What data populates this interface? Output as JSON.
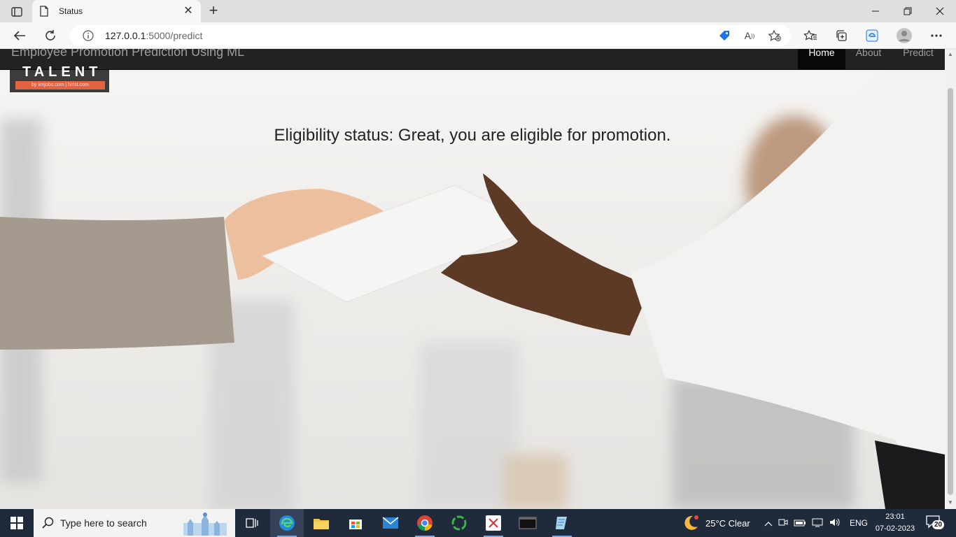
{
  "browser": {
    "tab_title": "Status",
    "address_host": "127.0.0.1",
    "address_path": ":5000/predict"
  },
  "navbar": {
    "brand": "Employee Promotion Prediction Using ML",
    "items": [
      "Home",
      "About",
      "Predict"
    ],
    "active": "Home"
  },
  "logo": {
    "word": "TALENT",
    "tagline": "by iimjobs.com | hirist.com"
  },
  "main": {
    "status_message": "Eligibility status: Great, you are eligible for promotion."
  },
  "taskbar": {
    "search_placeholder": "Type here to search",
    "weather": "25°C  Clear",
    "language": "ENG",
    "time": "23:01",
    "date": "07-02-2023",
    "notification_count": "20"
  },
  "colors": {
    "navbar_bg": "#222222",
    "navbar_active_bg": "#080808",
    "taskbar_bg": "#1f2a3b",
    "logo_strip": "#e3633f"
  }
}
